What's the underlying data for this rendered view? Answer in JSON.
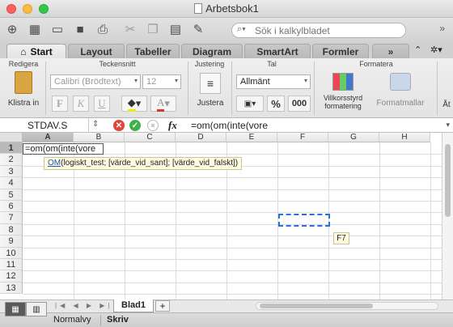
{
  "window": {
    "title": "Arbetsbok1"
  },
  "search": {
    "placeholder": "Sök i kalkylbladet"
  },
  "ribbon_tabs": [
    {
      "label": "Start",
      "active": true
    },
    {
      "label": "Layout"
    },
    {
      "label": "Tabeller"
    },
    {
      "label": "Diagram"
    },
    {
      "label": "SmartArt"
    },
    {
      "label": "Formler"
    }
  ],
  "ribbon": {
    "groups": {
      "edit": "Redigera",
      "font": "Teckensnitt",
      "align": "Justering",
      "number": "Tal",
      "format": "Formatera"
    },
    "paste_label": "Klistra in",
    "font_name": "Calibri (Brödtext)",
    "font_size": "12",
    "bold": "F",
    "italic": "K",
    "underline": "U",
    "align_label": "Justera",
    "number_format": "Allmänt",
    "percent": "%",
    "thousands": "000",
    "cond_format": "Villkorsstyrd formatering",
    "table_styles": "Formatmallar",
    "next_group_hint": "Åt"
  },
  "formula_bar": {
    "name_box": "STDAV.S",
    "fx": "fx",
    "formula": "=om(om(inte(vore"
  },
  "grid": {
    "columns": [
      "A",
      "B",
      "C",
      "D",
      "E",
      "F",
      "G",
      "H"
    ],
    "rows": [
      "1",
      "2",
      "3",
      "4",
      "5",
      "6",
      "7",
      "8",
      "9",
      "10",
      "11",
      "12",
      "13"
    ],
    "active_cell_text": "=om(om(inte(vore",
    "tooltip_fn": "OM",
    "tooltip_args": "(logiskt_test; [värde_vid_sant]; [värde_vid_falskt])",
    "key_hint": "F7"
  },
  "sheets": {
    "active": "Blad1",
    "add": "+"
  },
  "status": {
    "view": "Normalvy",
    "mode": "Skriv"
  },
  "colors": {
    "accent": "#2d6fd6",
    "close": "#fc605c",
    "min": "#fdbc40",
    "max": "#34c84a"
  }
}
